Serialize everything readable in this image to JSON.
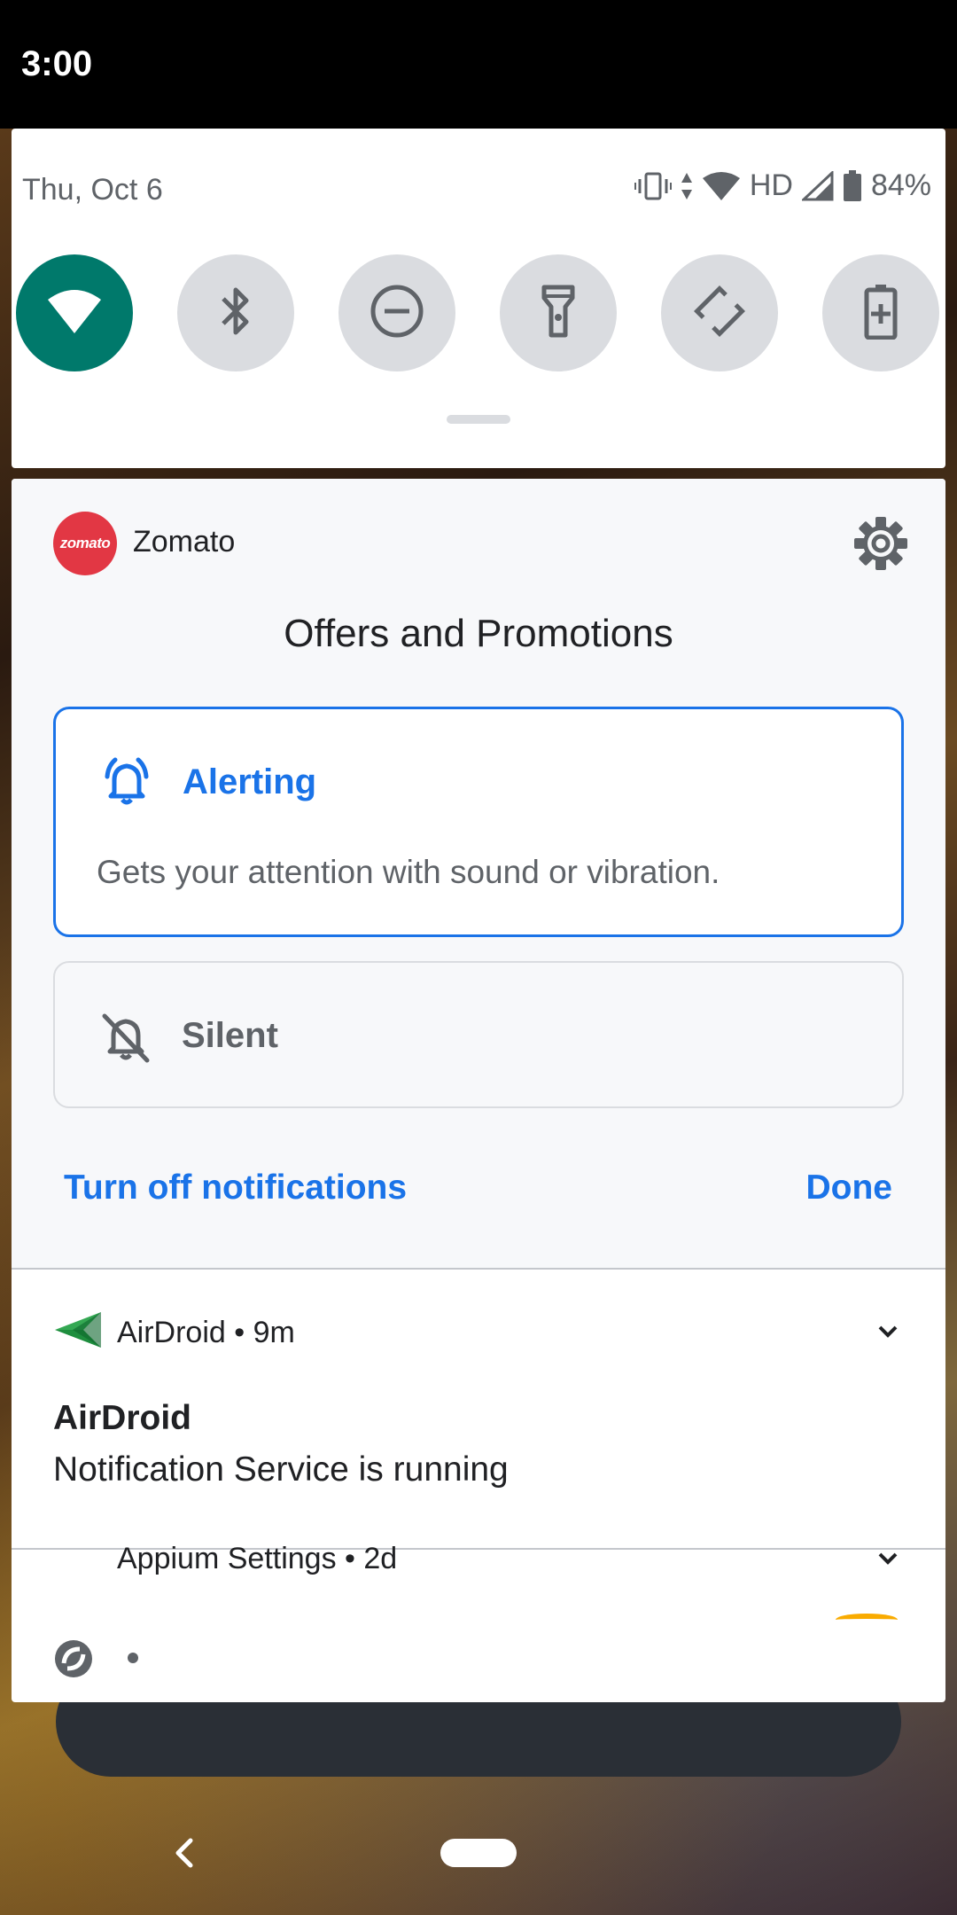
{
  "status_bar": {
    "time": "3:00"
  },
  "quick_settings": {
    "date": "Thu, Oct 6",
    "network_label": "HD",
    "battery": "84%",
    "tiles": [
      {
        "name": "wifi",
        "icon": "wifi-icon",
        "active": true
      },
      {
        "name": "bluetooth",
        "icon": "bluetooth-icon",
        "active": false
      },
      {
        "name": "do-not-disturb",
        "icon": "do-not-disturb-icon",
        "active": false
      },
      {
        "name": "flashlight",
        "icon": "flashlight-icon",
        "active": false
      },
      {
        "name": "auto-rotate",
        "icon": "auto-rotate-icon",
        "active": false
      },
      {
        "name": "battery-saver",
        "icon": "battery-saver-icon",
        "active": false
      }
    ]
  },
  "zomato": {
    "app_name": "Zomato",
    "logo_text": "zomato",
    "channel_title": "Offers and Promotions",
    "alerting_label": "Alerting",
    "alerting_desc": "Gets your attention with sound or vibration.",
    "silent_label": "Silent",
    "turn_off_label": "Turn off notifications",
    "done_label": "Done"
  },
  "airdroid": {
    "header": "AirDroid • 9m",
    "title": "AirDroid",
    "text": "Notification Service is running"
  },
  "appium": {
    "header": "Appium Settings • 2d"
  },
  "colors": {
    "accent": "#1a73e8",
    "wifi_active": "#00796b",
    "zomato_red": "#e23744"
  }
}
